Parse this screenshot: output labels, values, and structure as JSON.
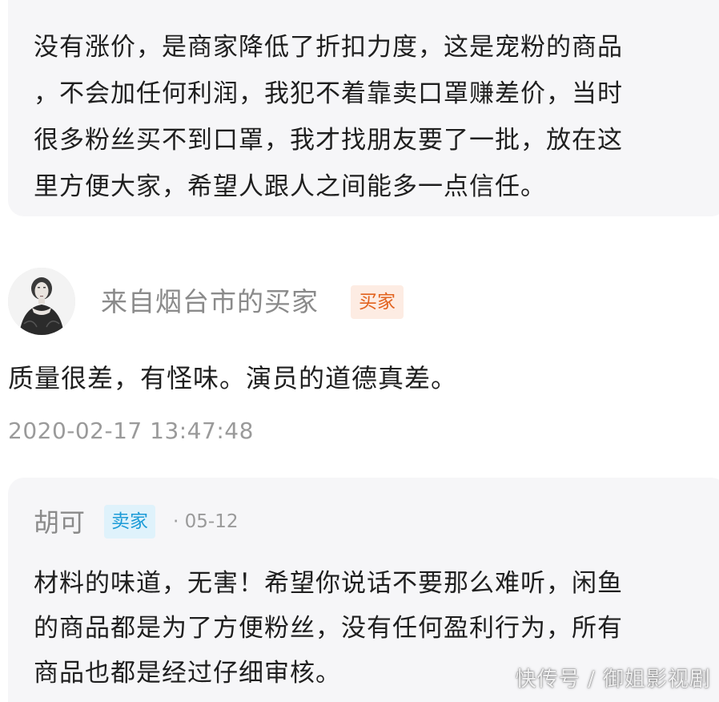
{
  "top_reply": {
    "lines": [
      "没有涨价，是商家降低了折扣力度，这是宠粉的商品",
      "，不会加任何利润，我犯不着靠卖口罩赚差价，当时",
      "很多粉丝买不到口罩，我才找朋友要了一批，放在这",
      "里方便大家，希望人跟人之间能多一点信任。"
    ]
  },
  "buyer": {
    "name": "来自烟台市的买家",
    "badge": "买家",
    "comment": "质量很差，有怪味。演员的道德真差。",
    "timestamp": "2020-02-17 13:47:48",
    "avatar_icon": "portrait-avatar-icon"
  },
  "seller_reply": {
    "name": "胡可",
    "badge": "卖家",
    "date": "· 05-12",
    "lines": [
      "材料的味道，无害！希望你说话不要那么难听，闲鱼",
      "的商品都是为了方便粉丝，没有任何盈利行为，所有",
      "商品也都是经过仔细审核。"
    ]
  },
  "watermark": "快传号 / 御姐影视剧",
  "colors": {
    "bubble_bg": "#f6f6f8",
    "buyer_badge_bg": "#fdece3",
    "buyer_badge_text": "#e2631f",
    "seller_badge_bg": "#dff2fb",
    "seller_badge_text": "#1b9bd7",
    "meta_gray": "#9a9a9a"
  }
}
